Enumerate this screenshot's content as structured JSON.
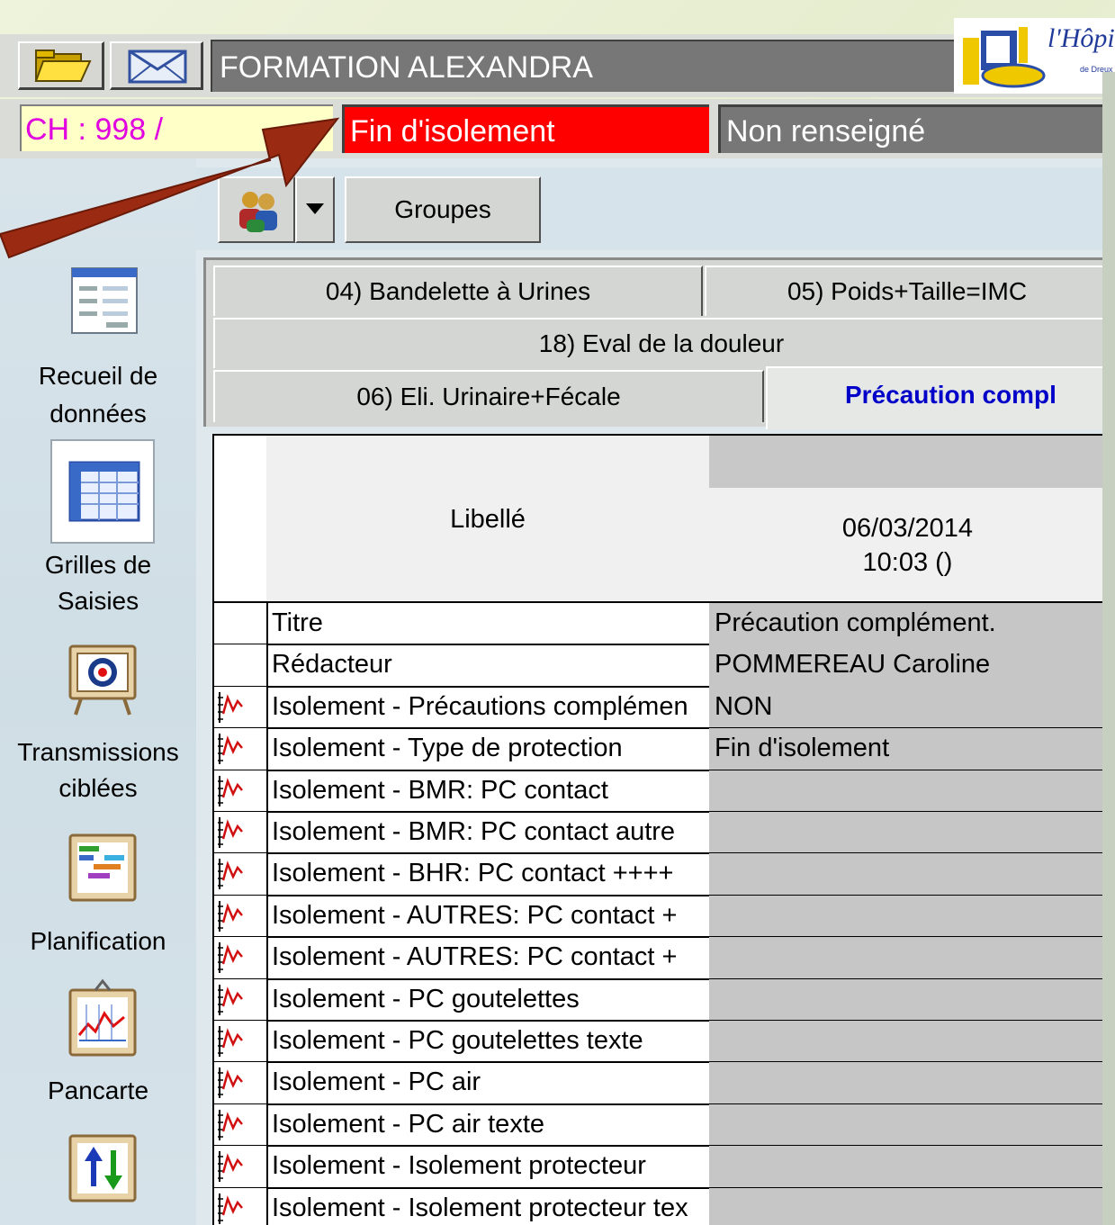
{
  "header": {
    "patient_name": "FORMATION ALEXANDRA",
    "logo_text": "l'Hôpital",
    "logo_subtext": "de Dreux"
  },
  "status": {
    "chambre": "CH : 998 /",
    "isolation_status": "Fin d'isolement",
    "info_status": "Non renseigné"
  },
  "toolbar": {
    "groupes_label": "Groupes"
  },
  "sidebar": {
    "items": [
      {
        "label_line1": "Recueil de",
        "label_line2": "données",
        "icon": "form-icon"
      },
      {
        "label_line1": "Grilles de",
        "label_line2": "Saisies",
        "icon": "grid-icon"
      },
      {
        "label_line1": "Transmissions",
        "label_line2": "ciblées",
        "icon": "target-icon"
      },
      {
        "label_line1": "Planification",
        "label_line2": "",
        "icon": "gantt-icon"
      },
      {
        "label_line1": "Pancarte",
        "label_line2": "",
        "icon": "chart-icon"
      },
      {
        "label_line1": "",
        "label_line2": "",
        "icon": "sort-arrows-icon"
      }
    ]
  },
  "tabs": {
    "row1": [
      "04) Bandelette à Urines",
      "05) Poids+Taille=IMC"
    ],
    "row2": [
      "18) Eval de la douleur"
    ],
    "row3": [
      "06) Eli. Urinaire+Fécale",
      "Précaution compl"
    ]
  },
  "grid": {
    "col_header_label": "Libellé",
    "date": "06/03/2014",
    "time": "10:03 ()",
    "rows": [
      {
        "label": "Titre",
        "value": "Précaution complément.",
        "chart": false
      },
      {
        "label": "Rédacteur",
        "value": "POMMEREAU Caroline",
        "chart": false
      },
      {
        "label": "Isolement - Précautions complémen",
        "value": "NON",
        "chart": true
      },
      {
        "label": "Isolement - Type de protection",
        "value": "Fin d'isolement",
        "chart": true
      },
      {
        "label": "Isolement - BMR: PC contact",
        "value": "",
        "chart": true
      },
      {
        "label": "Isolement - BMR: PC contact autre",
        "value": "",
        "chart": true
      },
      {
        "label": "Isolement - BHR: PC contact ++++",
        "value": "",
        "chart": true
      },
      {
        "label": "Isolement - AUTRES: PC contact +",
        "value": "",
        "chart": true
      },
      {
        "label": "Isolement - AUTRES: PC contact +",
        "value": "",
        "chart": true
      },
      {
        "label": "Isolement - PC goutelettes",
        "value": "",
        "chart": true
      },
      {
        "label": "Isolement - PC goutelettes texte",
        "value": "",
        "chart": true
      },
      {
        "label": "Isolement - PC air",
        "value": "",
        "chart": true
      },
      {
        "label": "Isolement - PC air texte",
        "value": "",
        "chart": true
      },
      {
        "label": "Isolement - Isolement protecteur",
        "value": "",
        "chart": true
      },
      {
        "label": "Isolement - Isolement protecteur tex",
        "value": "",
        "chart": true
      }
    ]
  },
  "colors": {
    "status_red": "#ff0000",
    "status_grey": "#777777",
    "chambre_text": "#e000e0",
    "active_tab_text": "#0000c8",
    "arrow": "#9b2a12"
  }
}
